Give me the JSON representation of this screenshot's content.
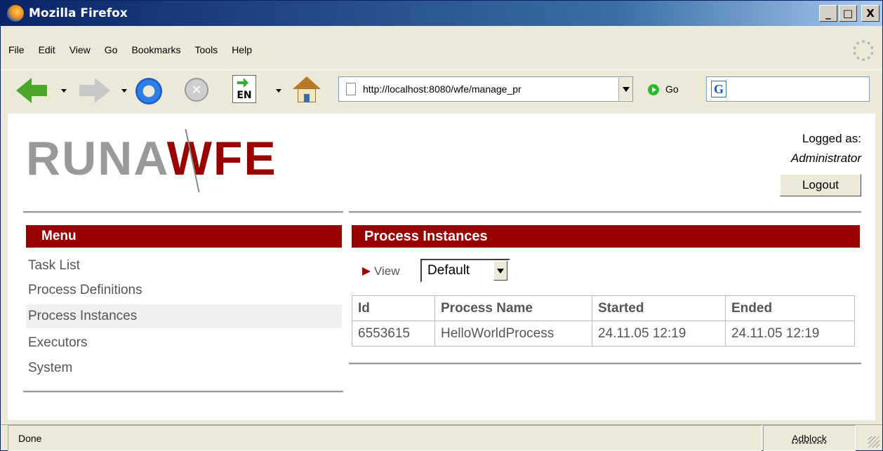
{
  "window": {
    "title": "Mozilla Firefox",
    "minimize_label": "_",
    "maximize_label": "□",
    "close_label": "X"
  },
  "menubar": {
    "items": [
      "File",
      "Edit",
      "View",
      "Go",
      "Bookmarks",
      "Tools",
      "Help"
    ]
  },
  "toolbar": {
    "url": "http://localhost:8080/wfe/manage_pr",
    "go_label": "Go",
    "language_label": "EN",
    "search_engine_letter": "G",
    "search_value": ""
  },
  "header": {
    "logo_left": "RUNA",
    "logo_right": "WFE",
    "logged_label": "Logged as:",
    "logged_user": "Administrator",
    "logout_label": "Logout"
  },
  "menu": {
    "title": "Menu",
    "items": [
      {
        "label": "Task List"
      },
      {
        "label": "Process Definitions"
      },
      {
        "label": "Process Instances",
        "active": true
      },
      {
        "label": "Executors"
      },
      {
        "label": "System"
      }
    ]
  },
  "main": {
    "title": "Process Instances",
    "view_label": "View",
    "view_selected": "Default",
    "table": {
      "headers": [
        "Id",
        "Process Name",
        "Started",
        "Ended"
      ],
      "rows": [
        [
          "6553615",
          "HelloWorldProcess",
          "24.11.05 12:19",
          "24.11.05 12:19"
        ]
      ]
    }
  },
  "status": {
    "text": "Done",
    "adblock": "Adblock"
  },
  "colors": {
    "brand_red": "#990000",
    "logo_gray": "#999999",
    "titlebar_blue": "#0a246a"
  }
}
